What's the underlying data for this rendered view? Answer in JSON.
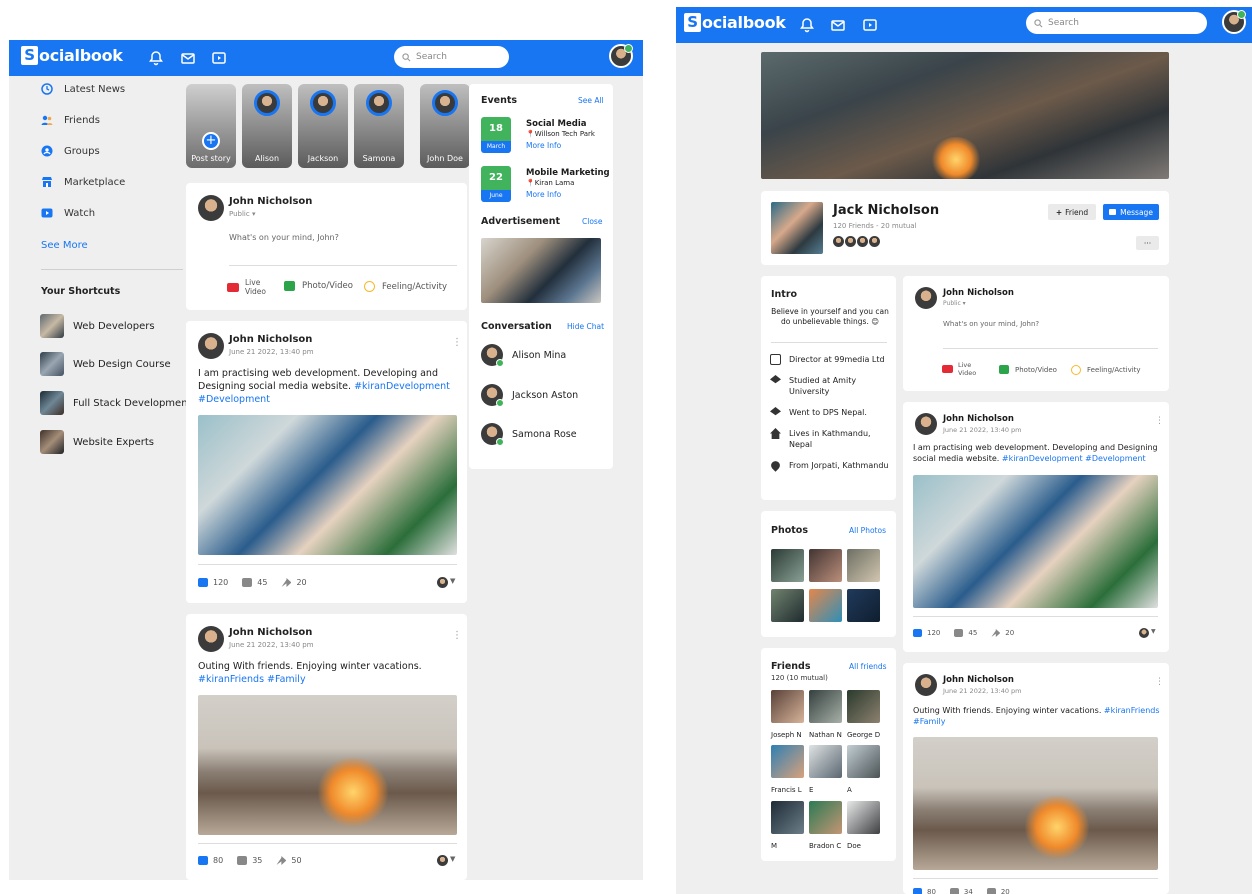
{
  "brand": {
    "logo_letter": "S",
    "logo_rest": "ocialbook",
    "accent": "#1876f2",
    "green": "#41b35d"
  },
  "search": {
    "placeholder": "Search"
  },
  "left_nav": {
    "items": [
      {
        "label": "Latest News",
        "icon": "clock-icon"
      },
      {
        "label": "Friends",
        "icon": "friends-icon"
      },
      {
        "label": "Groups",
        "icon": "groups-icon"
      },
      {
        "label": "Marketplace",
        "icon": "marketplace-icon"
      },
      {
        "label": "Watch",
        "icon": "watch-icon"
      }
    ],
    "see_more": "See More",
    "shortcuts_title": "Your Shortcuts",
    "shortcuts": [
      {
        "label": "Web Developers"
      },
      {
        "label": "Web Design Course"
      },
      {
        "label": "Full Stack Development"
      },
      {
        "label": "Website Experts"
      }
    ]
  },
  "stories": {
    "post_story": "Post story",
    "items": [
      {
        "name": "Alison"
      },
      {
        "name": "Jackson"
      },
      {
        "name": "Samona"
      },
      {
        "name": "John Doe"
      }
    ]
  },
  "composer": {
    "name": "John Nicholson",
    "privacy": "Public ▾",
    "placeholder": "What's on your mind, John?",
    "live_line1": "Live",
    "live_line2": "Video",
    "photo": "Photo/Video",
    "feeling": "Feeling/Activity"
  },
  "posts": [
    {
      "name": "John Nicholson",
      "time": "June 21 2022, 13:40 pm",
      "text": "I am practising web development. Developing and Designing social media website.",
      "tags": "#kiranDevelopment #Development",
      "likes": "120",
      "comments": "45",
      "shares": "20"
    },
    {
      "name": "John Nicholson",
      "time": "June 21 2022, 13:40 pm",
      "text": "Outing With friends. Enjoying winter vacations.",
      "tags": "#kiranFriends #Family",
      "likes": "80",
      "comments": "35",
      "shares": "50"
    }
  ],
  "events": {
    "title": "Events",
    "see_all": "See All",
    "items": [
      {
        "day": "18",
        "month": "March",
        "title": "Social Media",
        "place": "Willson Tech Park",
        "more": "More Info"
      },
      {
        "day": "22",
        "month": "June",
        "title": "Mobile Marketing",
        "place": "Kiran Lama",
        "more": "More Info"
      }
    ]
  },
  "ad": {
    "title": "Advertisement",
    "close": "Close"
  },
  "conversation": {
    "title": "Conversation",
    "hide": "Hide Chat",
    "items": [
      {
        "name": "Alison Mina"
      },
      {
        "name": "Jackson Aston"
      },
      {
        "name": "Samona Rose"
      }
    ]
  },
  "profile": {
    "name": "Jack Nicholson",
    "stats": "120 Friends - 20 mutual",
    "friend_btn": "Friend",
    "message_btn": "Message",
    "more": "···",
    "intro": {
      "title": "Intro",
      "bio": "Believe in yourself and you can do unbelievable things. 😊",
      "items": [
        {
          "icon": "briefcase-icon",
          "text": "Director at 99media Ltd"
        },
        {
          "icon": "graduation-icon",
          "text": "Studied at Amity University"
        },
        {
          "icon": "graduation-icon",
          "text": "Went to DPS Nepal."
        },
        {
          "icon": "home-icon",
          "text": "Lives in Kathmandu, Nepal"
        },
        {
          "icon": "location-icon",
          "text": "From Jorpati, Kathmandu"
        }
      ]
    },
    "photos": {
      "title": "Photos",
      "link": "All Photos"
    },
    "friends": {
      "title": "Friends",
      "link": "All friends",
      "count": "120 (10 mutual)",
      "names": [
        "Joseph N",
        "Nathan N",
        "George D",
        "Francis L",
        "E",
        "A",
        "M",
        "Bradon C",
        "Doe"
      ]
    }
  },
  "profile_posts": [
    {
      "name": "John Nicholson",
      "time": "June 21 2022, 13:40 pm",
      "text": "I am practising web development. Developing and Designing social media website.",
      "tags": "#kiranDevelopment #Development",
      "likes": "120",
      "comments": "45",
      "shares": "20"
    },
    {
      "name": "John Nicholson",
      "time": "June 21 2022, 13:40 pm",
      "text": "Outing With friends. Enjoying winter vacations.",
      "tags": "#kiranFriends #Family",
      "likes": "80",
      "comments": "34",
      "shares": "20"
    }
  ]
}
